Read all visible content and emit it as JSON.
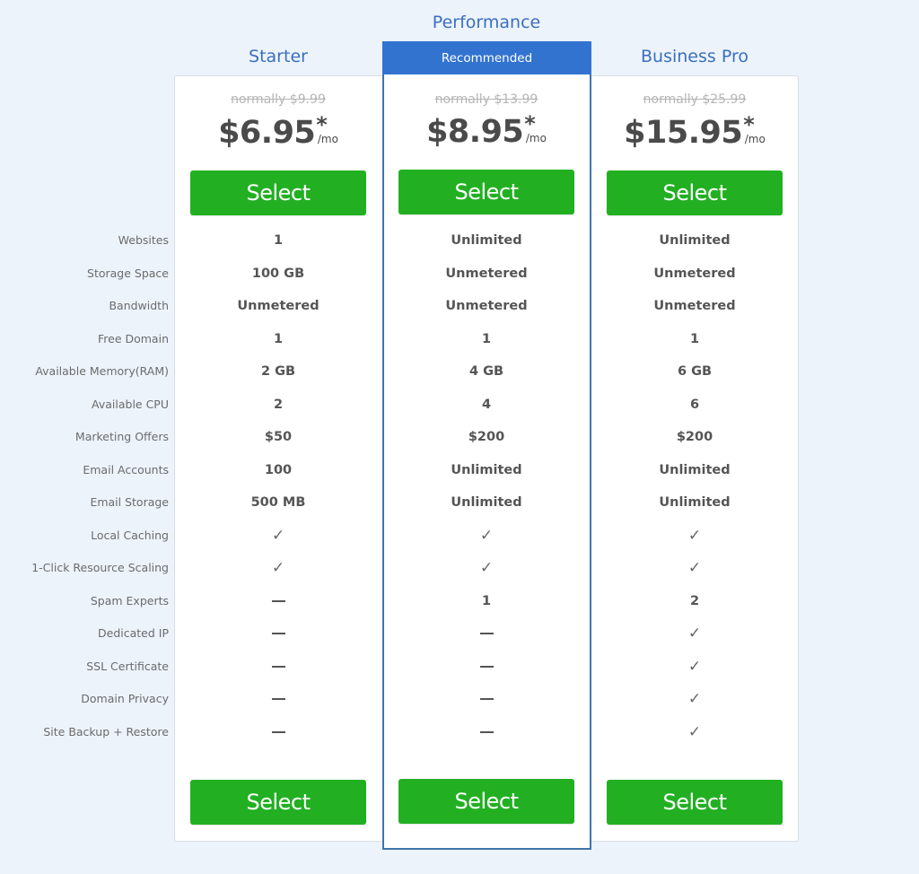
{
  "feature_labels": [
    "Websites",
    "Storage Space",
    "Bandwidth",
    "Free Domain",
    "Available Memory(RAM)",
    "Available CPU",
    "Marketing Offers",
    "Email Accounts",
    "Email Storage",
    "Local Caching",
    "1-Click Resource Scaling",
    "Spam Experts",
    "Dedicated IP",
    "SSL Certificate",
    "Domain Privacy",
    "Site Backup + Restore"
  ],
  "plans": [
    {
      "name": "Starter",
      "normally": "normally $9.99",
      "price": "$6.95",
      "asterisk": "*",
      "per": "/mo",
      "select_label": "Select",
      "values": [
        "1",
        "100 GB",
        "Unmetered",
        "1",
        "2 GB",
        "2",
        "$50",
        "100",
        "500 MB",
        "check",
        "check",
        "dash",
        "dash",
        "dash",
        "dash",
        "dash"
      ]
    },
    {
      "name": "Performance",
      "badge": "Recommended",
      "normally": "normally $13.99",
      "price": "$8.95",
      "asterisk": "*",
      "per": "/mo",
      "select_label": "Select",
      "values": [
        "Unlimited",
        "Unmetered",
        "Unmetered",
        "1",
        "4 GB",
        "4",
        "$200",
        "Unlimited",
        "Unlimited",
        "check",
        "check",
        "1",
        "dash",
        "dash",
        "dash",
        "dash"
      ]
    },
    {
      "name": "Business Pro",
      "normally": "normally $25.99",
      "price": "$15.95",
      "asterisk": "*",
      "per": "/mo",
      "select_label": "Select",
      "values": [
        "Unlimited",
        "Unmetered",
        "Unmetered",
        "1",
        "6 GB",
        "6",
        "$200",
        "Unlimited",
        "Unlimited",
        "check",
        "check",
        "2",
        "check",
        "check",
        "check",
        "check"
      ]
    }
  ],
  "symbols": {
    "check": "✓"
  },
  "colors": {
    "accent": "#3273d0",
    "title": "#3a6fbf",
    "button": "#22b022"
  }
}
